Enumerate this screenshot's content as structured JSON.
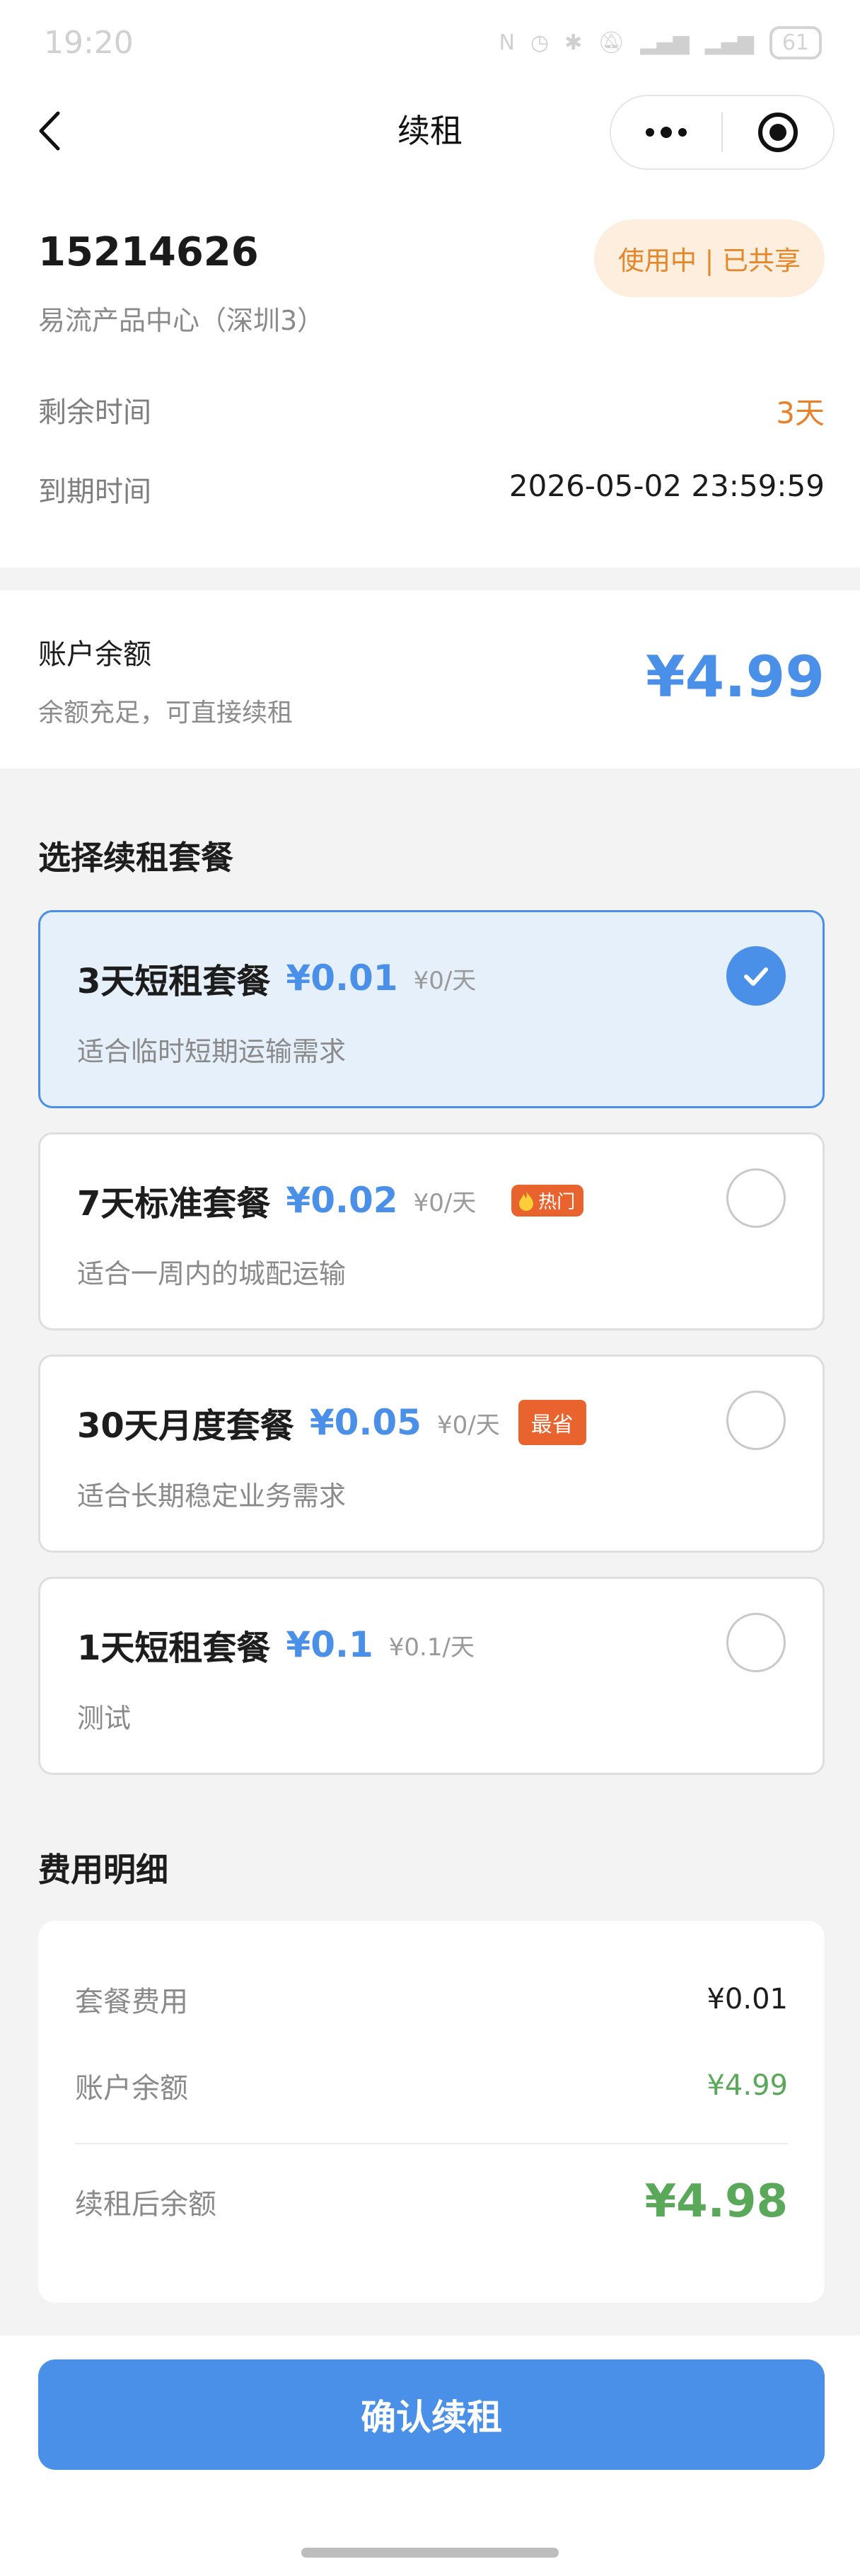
{
  "status_bar": {
    "time": "19:20",
    "icons": [
      "nfc-icon",
      "alarm-icon",
      "bluetooth-icon",
      "mute-icon",
      "signal-5g-icon",
      "signal-5g-icon"
    ],
    "battery": "61"
  },
  "navbar": {
    "title": "续租"
  },
  "device": {
    "id": "15214626",
    "company": "易流产品中心（深圳3）",
    "status_badge": "使用中 | 已共享",
    "remaining_label": "剩余时间",
    "remaining_value": "3天",
    "expire_label": "到期时间",
    "expire_value": "2026-05-02 23:59:59"
  },
  "balance": {
    "title": "账户余额",
    "subtitle": "余额充足，可直接续租",
    "amount": "¥4.99"
  },
  "plans_section": {
    "title": "选择续租套餐",
    "plans": [
      {
        "name": "3天短租套餐",
        "price": "¥0.01",
        "unit": "¥0/天",
        "desc": "适合临时短期运输需求",
        "selected": true
      },
      {
        "name": "7天标准套餐",
        "price": "¥0.02",
        "unit": "¥0/天",
        "desc": "适合一周内的城配运输",
        "tag": "热门",
        "selected": false
      },
      {
        "name": "30天月度套餐",
        "price": "¥0.05",
        "unit": "¥0/天",
        "desc": "适合长期稳定业务需求",
        "tag": "最省",
        "selected": false
      },
      {
        "name": "1天短租套餐",
        "price": "¥0.1",
        "unit": "¥0.1/天",
        "desc": "测试",
        "selected": false
      }
    ]
  },
  "fee_section": {
    "title": "费用明细",
    "package_fee_label": "套餐费用",
    "package_fee_value": "¥0.01",
    "balance_label": "账户余额",
    "balance_value": "¥4.99",
    "after_label": "续租后余额",
    "after_value": "¥4.98"
  },
  "footer": {
    "confirm_label": "确认续租"
  },
  "colors": {
    "accent": "#4a90e8",
    "warning": "#e8822a",
    "success": "#5aa85a",
    "hot_tag": "#e8632e"
  }
}
